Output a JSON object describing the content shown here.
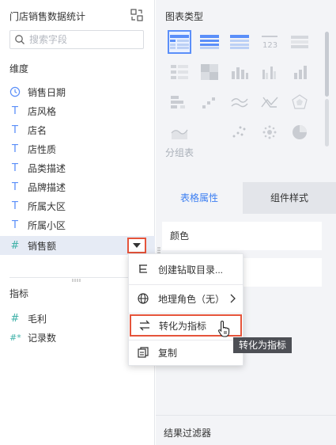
{
  "left": {
    "dataset_title": "门店销售数据统计",
    "search_placeholder": "搜索字段",
    "dimensions_label": "维度",
    "dimensions": [
      {
        "type": "clock",
        "name": "销售日期"
      },
      {
        "type": "T",
        "name": "店风格"
      },
      {
        "type": "T",
        "name": "店名"
      },
      {
        "type": "T",
        "name": "店性质"
      },
      {
        "type": "T",
        "name": "品类描述"
      },
      {
        "type": "T",
        "name": "品牌描述"
      },
      {
        "type": "T",
        "name": "所属大区"
      },
      {
        "type": "T",
        "name": "所属小区"
      },
      {
        "type": "#",
        "name": "销售额"
      }
    ],
    "measures_label": "指标",
    "measures": [
      {
        "type": "#",
        "name": "毛利"
      },
      {
        "type": "#*",
        "name": "记录数"
      }
    ]
  },
  "context_menu": {
    "items": [
      {
        "icon": "drill-directory-icon",
        "label": "创建钻取目录..."
      },
      {
        "icon": "globe-icon",
        "label": "地理角色（无）"
      },
      {
        "icon": "swap-icon",
        "label": "转化为指标"
      },
      {
        "icon": "copy-icon",
        "label": "复制"
      }
    ],
    "tooltip": "转化为指标"
  },
  "right": {
    "chart_type_title": "图表类型",
    "group_label": "分组表",
    "tabs": [
      "表格属性",
      "组件样式"
    ],
    "property_rows": [
      "颜色"
    ],
    "filter_title": "结果过滤器"
  },
  "colors": {
    "accent": "#3d7ff2",
    "highlight_border": "#e5543b",
    "type_blue": "#5b8ff9",
    "type_teal": "#3fb1a8"
  }
}
